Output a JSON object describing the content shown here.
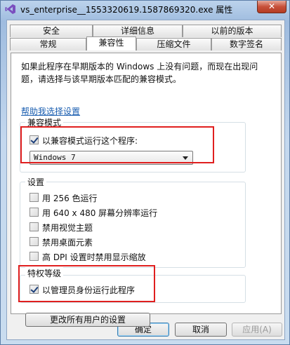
{
  "window": {
    "title": "vs_enterprise__1553320619.1587869320.exe 属性",
    "close_label": "✕",
    "icon": "visual-studio-icon"
  },
  "tabs": {
    "row_back": [
      "安全",
      "详细信息",
      "以前的版本"
    ],
    "row_front": [
      "常规",
      "兼容性",
      "压缩文件",
      "数字签名"
    ],
    "active": "兼容性"
  },
  "compat": {
    "description": "如果此程序在早期版本的 Windows 上没有问题，而现在出现问题，请选择与该早期版本匹配的兼容模式。",
    "help_link": "帮助我选择设置",
    "mode_group_title": "兼容模式",
    "mode_checkbox_label": "以兼容模式运行这个程序:",
    "mode_checked": true,
    "mode_selected": "Windows 7"
  },
  "settings": {
    "group_title": "设置",
    "items": [
      {
        "label": "用 256 色运行",
        "checked": false
      },
      {
        "label": "用 640 x 480 屏幕分辨率运行",
        "checked": false
      },
      {
        "label": "禁用视觉主题",
        "checked": false
      },
      {
        "label": "禁用桌面元素",
        "checked": false
      },
      {
        "label": "高 DPI 设置时禁用显示缩放",
        "checked": false
      }
    ]
  },
  "privilege": {
    "group_title": "特权等级",
    "admin_label": "以管理员身份运行此程序",
    "admin_checked": true
  },
  "change_all_button": "更改所有用户的设置",
  "buttons": {
    "ok": "确定",
    "cancel": "取消",
    "apply": "应用(A)"
  },
  "colors": {
    "highlight_box": "#e01f1f",
    "link": "#1a5eb0"
  }
}
